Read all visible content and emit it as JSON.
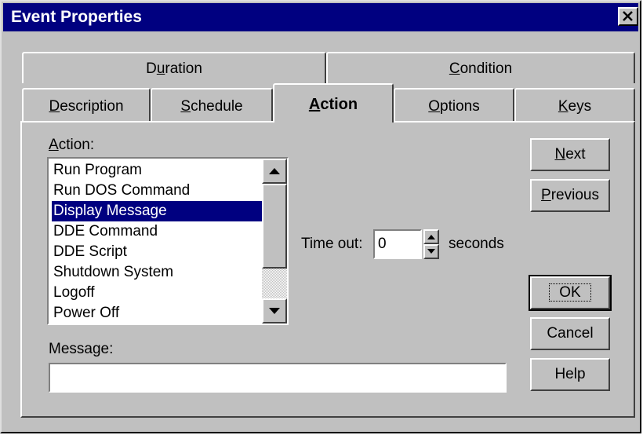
{
  "window": {
    "title": "Event Properties"
  },
  "tabs": {
    "row1": [
      {
        "pre": "D",
        "ul": "u",
        "post": "ration"
      },
      {
        "pre": "",
        "ul": "C",
        "post": "ondition"
      }
    ],
    "row2": [
      {
        "pre": "",
        "ul": "D",
        "post": "escription"
      },
      {
        "pre": "",
        "ul": "S",
        "post": "chedule"
      },
      {
        "pre": "",
        "ul": "A",
        "post": "ction"
      },
      {
        "pre": "",
        "ul": "O",
        "post": "ptions"
      },
      {
        "pre": "",
        "ul": "K",
        "post": "eys"
      }
    ],
    "active": "Action"
  },
  "action": {
    "label_ul": "A",
    "label_rest": "ction:",
    "items": [
      "Run Program",
      "Run DOS Command",
      "Display Message",
      "DDE Command",
      "DDE Script",
      "Shutdown System",
      "Logoff",
      "Power Off"
    ],
    "selected": "Display Message"
  },
  "timeout": {
    "label": "Time out:",
    "value": "0",
    "unit": "seconds"
  },
  "message": {
    "label": "Message:",
    "value": ""
  },
  "buttons": {
    "next": {
      "ul": "N",
      "rest": "ext"
    },
    "previous": {
      "ul": "P",
      "rest": "revious"
    },
    "ok": "OK",
    "cancel": "Cancel",
    "help": "Help"
  }
}
